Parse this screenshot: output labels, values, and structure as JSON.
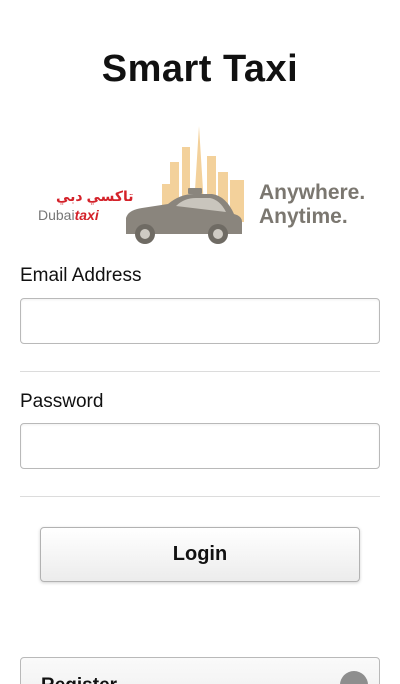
{
  "header": {
    "title": "Smart Taxi"
  },
  "banner": {
    "brand_arabic": "تاكسي دبي",
    "brand_latin_prefix": "Dubai",
    "brand_latin_suffix": "taxi",
    "tagline_line1": "Anywhere.",
    "tagline_line2": "Anytime.",
    "skyline_color": "#f2c98a",
    "car_color": "#8a857d",
    "brand_red": "#d4222a"
  },
  "form": {
    "email_label": "Email Address",
    "email_value": "",
    "password_label": "Password",
    "password_value": "",
    "login_label": "Login"
  },
  "register": {
    "label": "Register",
    "icon": "chevron-right-icon"
  }
}
